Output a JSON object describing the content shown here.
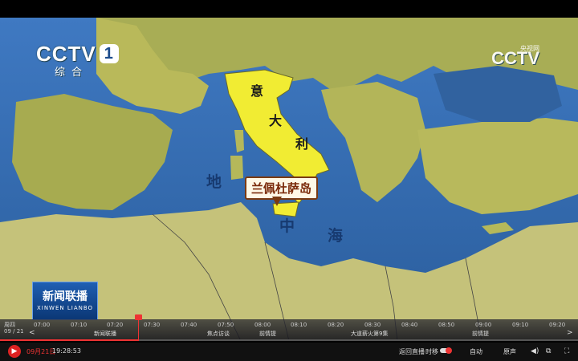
{
  "channel": {
    "logo": "CCTV",
    "number": "1",
    "subtitle": "综合",
    "right_logo": "CCTV",
    "right_sub": "央视网"
  },
  "map": {
    "labels": {
      "italy_1": "意",
      "italy_2": "大",
      "italy_3": "利",
      "sea_1": "地",
      "sea_2": "中",
      "sea_3": "海"
    },
    "callout": "兰佩杜萨岛"
  },
  "program_logo": {
    "title": "新闻联播",
    "pinyin": "XINWEN LIANBO"
  },
  "timeline": {
    "day": "周四",
    "date": "09 / 21",
    "ticks": [
      "07:00",
      "07:10",
      "07:20",
      "07:30",
      "07:40",
      "07:50",
      "08:00",
      "08:10",
      "08:20",
      "08:30",
      "08:40",
      "08:50",
      "09:00",
      "09:10",
      "09:20"
    ],
    "programs": [
      {
        "label": "新闻联播"
      },
      {
        "label": "焦点访谈"
      },
      {
        "label": "前情提"
      },
      {
        "label": "大道薪火第9集"
      },
      {
        "label": "前情提"
      }
    ],
    "prev": "<",
    "next": ">"
  },
  "controls": {
    "play_icon": "play-icon",
    "date": "09月21日",
    "time": "19:28:53",
    "return_live": "返回直播",
    "timeshift": "时移",
    "auto": "自动",
    "original_sound": "原声"
  }
}
